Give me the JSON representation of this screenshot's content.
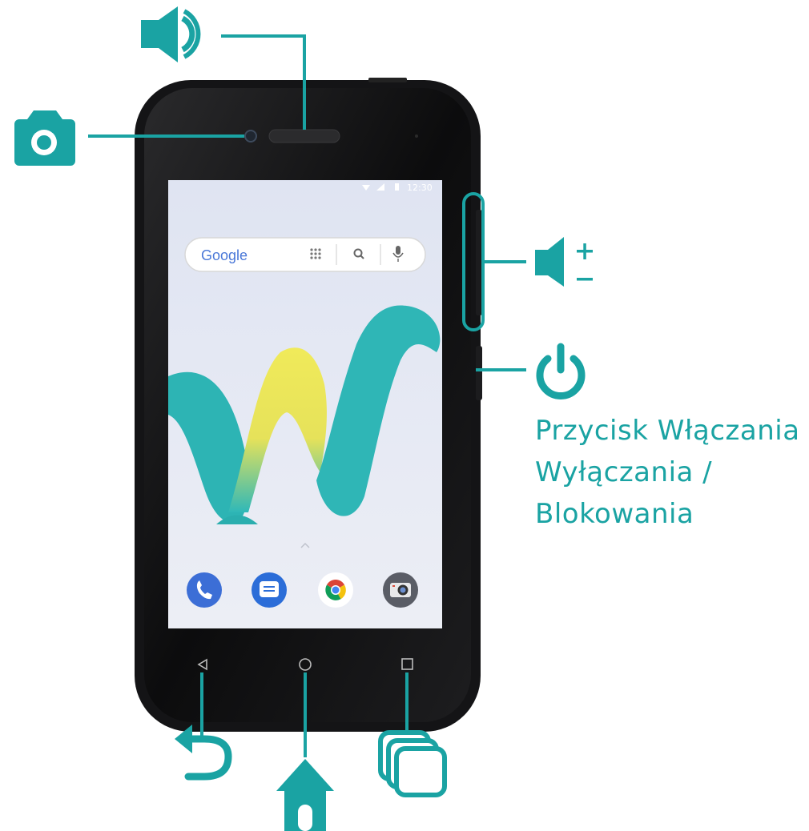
{
  "accent_color": "#1aa3a3",
  "phone": {
    "status_bar": {
      "time": "12:30"
    },
    "search_bar": {
      "brand": "Google"
    },
    "dock_apps": [
      "phone-icon",
      "messages-icon",
      "chrome-icon",
      "camera-icon"
    ],
    "nav_buttons": [
      "back-icon",
      "home-icon",
      "recents-icon"
    ]
  },
  "callouts": {
    "speaker": "speaker-icon",
    "front_camera": "camera-icon",
    "volume": "volume-plus-minus-icon",
    "power": "power-icon",
    "back": "back-arrow-icon",
    "home": "home-icon",
    "recents": "recent-apps-icon"
  },
  "power_caption": {
    "line1": "Przycisk Włączania",
    "line2": "Wyłączania /",
    "line3": "Blokowania"
  }
}
